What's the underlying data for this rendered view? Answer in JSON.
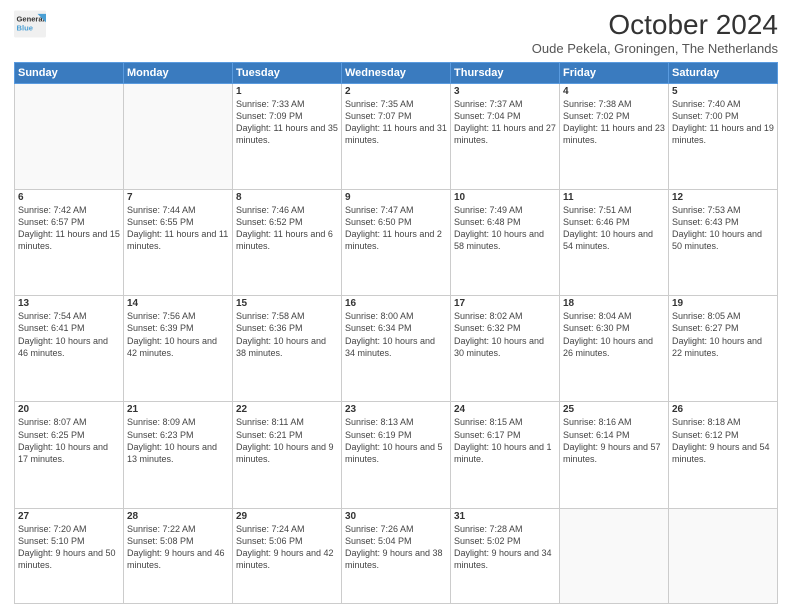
{
  "header": {
    "logo_line1": "General",
    "logo_line2": "Blue",
    "title": "October 2024",
    "subtitle": "Oude Pekela, Groningen, The Netherlands"
  },
  "weekdays": [
    "Sunday",
    "Monday",
    "Tuesday",
    "Wednesday",
    "Thursday",
    "Friday",
    "Saturday"
  ],
  "weeks": [
    [
      {
        "day": "",
        "sunrise": "",
        "sunset": "",
        "daylight": ""
      },
      {
        "day": "",
        "sunrise": "",
        "sunset": "",
        "daylight": ""
      },
      {
        "day": "1",
        "sunrise": "Sunrise: 7:33 AM",
        "sunset": "Sunset: 7:09 PM",
        "daylight": "Daylight: 11 hours and 35 minutes."
      },
      {
        "day": "2",
        "sunrise": "Sunrise: 7:35 AM",
        "sunset": "Sunset: 7:07 PM",
        "daylight": "Daylight: 11 hours and 31 minutes."
      },
      {
        "day": "3",
        "sunrise": "Sunrise: 7:37 AM",
        "sunset": "Sunset: 7:04 PM",
        "daylight": "Daylight: 11 hours and 27 minutes."
      },
      {
        "day": "4",
        "sunrise": "Sunrise: 7:38 AM",
        "sunset": "Sunset: 7:02 PM",
        "daylight": "Daylight: 11 hours and 23 minutes."
      },
      {
        "day": "5",
        "sunrise": "Sunrise: 7:40 AM",
        "sunset": "Sunset: 7:00 PM",
        "daylight": "Daylight: 11 hours and 19 minutes."
      }
    ],
    [
      {
        "day": "6",
        "sunrise": "Sunrise: 7:42 AM",
        "sunset": "Sunset: 6:57 PM",
        "daylight": "Daylight: 11 hours and 15 minutes."
      },
      {
        "day": "7",
        "sunrise": "Sunrise: 7:44 AM",
        "sunset": "Sunset: 6:55 PM",
        "daylight": "Daylight: 11 hours and 11 minutes."
      },
      {
        "day": "8",
        "sunrise": "Sunrise: 7:46 AM",
        "sunset": "Sunset: 6:52 PM",
        "daylight": "Daylight: 11 hours and 6 minutes."
      },
      {
        "day": "9",
        "sunrise": "Sunrise: 7:47 AM",
        "sunset": "Sunset: 6:50 PM",
        "daylight": "Daylight: 11 hours and 2 minutes."
      },
      {
        "day": "10",
        "sunrise": "Sunrise: 7:49 AM",
        "sunset": "Sunset: 6:48 PM",
        "daylight": "Daylight: 10 hours and 58 minutes."
      },
      {
        "day": "11",
        "sunrise": "Sunrise: 7:51 AM",
        "sunset": "Sunset: 6:46 PM",
        "daylight": "Daylight: 10 hours and 54 minutes."
      },
      {
        "day": "12",
        "sunrise": "Sunrise: 7:53 AM",
        "sunset": "Sunset: 6:43 PM",
        "daylight": "Daylight: 10 hours and 50 minutes."
      }
    ],
    [
      {
        "day": "13",
        "sunrise": "Sunrise: 7:54 AM",
        "sunset": "Sunset: 6:41 PM",
        "daylight": "Daylight: 10 hours and 46 minutes."
      },
      {
        "day": "14",
        "sunrise": "Sunrise: 7:56 AM",
        "sunset": "Sunset: 6:39 PM",
        "daylight": "Daylight: 10 hours and 42 minutes."
      },
      {
        "day": "15",
        "sunrise": "Sunrise: 7:58 AM",
        "sunset": "Sunset: 6:36 PM",
        "daylight": "Daylight: 10 hours and 38 minutes."
      },
      {
        "day": "16",
        "sunrise": "Sunrise: 8:00 AM",
        "sunset": "Sunset: 6:34 PM",
        "daylight": "Daylight: 10 hours and 34 minutes."
      },
      {
        "day": "17",
        "sunrise": "Sunrise: 8:02 AM",
        "sunset": "Sunset: 6:32 PM",
        "daylight": "Daylight: 10 hours and 30 minutes."
      },
      {
        "day": "18",
        "sunrise": "Sunrise: 8:04 AM",
        "sunset": "Sunset: 6:30 PM",
        "daylight": "Daylight: 10 hours and 26 minutes."
      },
      {
        "day": "19",
        "sunrise": "Sunrise: 8:05 AM",
        "sunset": "Sunset: 6:27 PM",
        "daylight": "Daylight: 10 hours and 22 minutes."
      }
    ],
    [
      {
        "day": "20",
        "sunrise": "Sunrise: 8:07 AM",
        "sunset": "Sunset: 6:25 PM",
        "daylight": "Daylight: 10 hours and 17 minutes."
      },
      {
        "day": "21",
        "sunrise": "Sunrise: 8:09 AM",
        "sunset": "Sunset: 6:23 PM",
        "daylight": "Daylight: 10 hours and 13 minutes."
      },
      {
        "day": "22",
        "sunrise": "Sunrise: 8:11 AM",
        "sunset": "Sunset: 6:21 PM",
        "daylight": "Daylight: 10 hours and 9 minutes."
      },
      {
        "day": "23",
        "sunrise": "Sunrise: 8:13 AM",
        "sunset": "Sunset: 6:19 PM",
        "daylight": "Daylight: 10 hours and 5 minutes."
      },
      {
        "day": "24",
        "sunrise": "Sunrise: 8:15 AM",
        "sunset": "Sunset: 6:17 PM",
        "daylight": "Daylight: 10 hours and 1 minute."
      },
      {
        "day": "25",
        "sunrise": "Sunrise: 8:16 AM",
        "sunset": "Sunset: 6:14 PM",
        "daylight": "Daylight: 9 hours and 57 minutes."
      },
      {
        "day": "26",
        "sunrise": "Sunrise: 8:18 AM",
        "sunset": "Sunset: 6:12 PM",
        "daylight": "Daylight: 9 hours and 54 minutes."
      }
    ],
    [
      {
        "day": "27",
        "sunrise": "Sunrise: 7:20 AM",
        "sunset": "Sunset: 5:10 PM",
        "daylight": "Daylight: 9 hours and 50 minutes."
      },
      {
        "day": "28",
        "sunrise": "Sunrise: 7:22 AM",
        "sunset": "Sunset: 5:08 PM",
        "daylight": "Daylight: 9 hours and 46 minutes."
      },
      {
        "day": "29",
        "sunrise": "Sunrise: 7:24 AM",
        "sunset": "Sunset: 5:06 PM",
        "daylight": "Daylight: 9 hours and 42 minutes."
      },
      {
        "day": "30",
        "sunrise": "Sunrise: 7:26 AM",
        "sunset": "Sunset: 5:04 PM",
        "daylight": "Daylight: 9 hours and 38 minutes."
      },
      {
        "day": "31",
        "sunrise": "Sunrise: 7:28 AM",
        "sunset": "Sunset: 5:02 PM",
        "daylight": "Daylight: 9 hours and 34 minutes."
      },
      {
        "day": "",
        "sunrise": "",
        "sunset": "",
        "daylight": ""
      },
      {
        "day": "",
        "sunrise": "",
        "sunset": "",
        "daylight": ""
      }
    ]
  ]
}
